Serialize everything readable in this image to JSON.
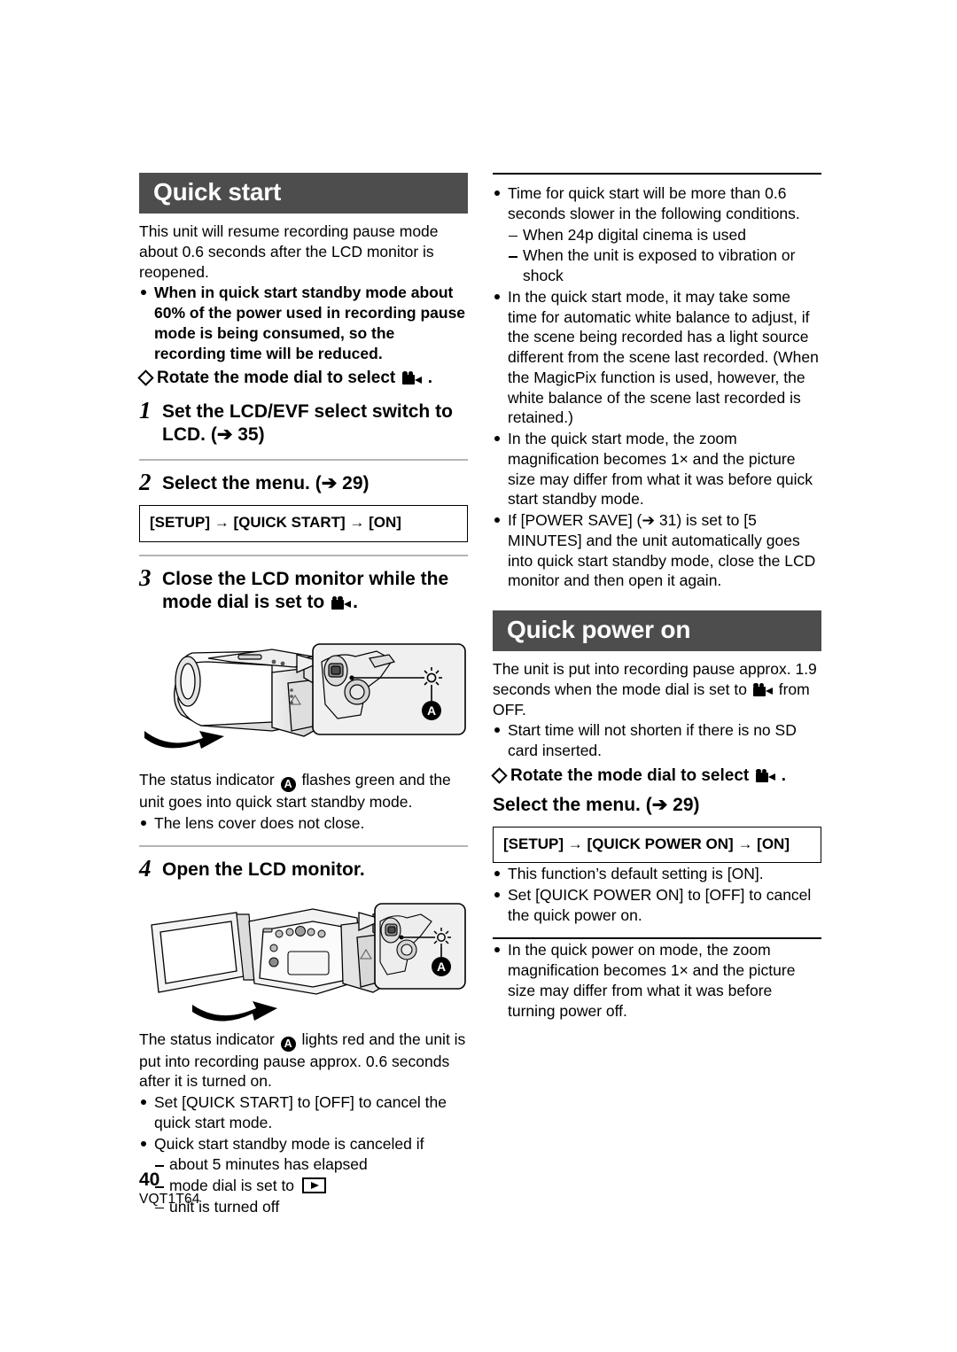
{
  "left": {
    "section_title": "Quick start",
    "intro": "This unit will resume recording pause mode about 0.6 seconds after the LCD monitor is reopened.",
    "intro_bullets": [
      "When in quick start standby mode about 60% of the power used in recording pause mode is being consumed, so the recording time will be reduced."
    ],
    "dial_prompt": "Rotate the mode dial to select",
    "dial_prompt_suffix": ".",
    "steps": [
      {
        "num": "1",
        "text": "Set the LCD/EVF select switch to LCD. (➔ 35)"
      },
      {
        "num": "2",
        "text": "Select the menu. (➔ 29)"
      },
      {
        "num": "3",
        "text_before": "Close the LCD monitor while the mode dial is set to",
        "text_after": "."
      },
      {
        "num": "4",
        "text": "Open the LCD monitor."
      }
    ],
    "menu_path": "[SETUP] → [QUICK START] → [ON]",
    "fig1_caption_before": "The status indicator",
    "fig1_caption_after": "flashes green and the unit goes into quick start standby mode.",
    "fig1_bullets": [
      "The lens cover does not close."
    ],
    "fig2_caption_before": "The status indicator",
    "fig2_caption_after": "lights red and the unit is put into recording pause approx. 0.6 seconds after it is turned on.",
    "fig2_bullets": [
      "Set [QUICK START] to [OFF] to cancel the quick start mode."
    ],
    "cancel_lead": "Quick start standby mode is canceled if",
    "cancel_items": [
      {
        "text": "about 5 minutes has elapsed",
        "icon": null
      },
      {
        "text": "mode dial is set to",
        "icon": "play-icon"
      },
      {
        "text": "unit is turned off",
        "icon": null
      }
    ],
    "badge_label": "A"
  },
  "right": {
    "top_bullets": [
      {
        "text": "Time for quick start will be more than 0.6 seconds slower in the following conditions.",
        "sub": [
          "When 24p digital cinema is used",
          "When the unit is exposed to vibration or shock"
        ]
      },
      {
        "text": "In the quick start mode, it may take some time for automatic white balance to adjust, if the scene being recorded has a light source different from the scene last recorded. (When the MagicPix function is used, however, the white balance of the scene last recorded is retained.)",
        "sub": []
      },
      {
        "text": "In the quick start mode, the zoom magnification becomes 1× and the picture size may differ from what it was before quick start standby mode.",
        "sub": []
      },
      {
        "text": "If [POWER SAVE] (➔ 31) is set to [5 MINUTES] and the unit automatically goes into quick start standby mode, close the LCD monitor and then open it again.",
        "sub": []
      }
    ],
    "section_title": "Quick power on",
    "intro_before": "The unit is put into recording pause approx. 1.9 seconds when the mode dial is set to",
    "intro_after": "from OFF.",
    "intro_bullets": [
      "Start time will not shorten if there is no SD card inserted."
    ],
    "dial_prompt": "Rotate the mode dial to select",
    "dial_prompt_suffix": ".",
    "select_menu": "Select the menu. (➔ 29)",
    "menu_path": "[SETUP] → [QUICK POWER ON] → [ON]",
    "after_bullets": [
      "This function’s default setting is [ON].",
      "Set [QUICK POWER ON] to [OFF] to cancel the quick power on."
    ],
    "final_bullets": [
      "In the quick power on mode, the zoom magnification becomes 1× and the picture size may differ from what it was before turning power off."
    ]
  },
  "footer": {
    "page_number": "40",
    "doc_code": "VQT1T64"
  },
  "colors": {
    "header_bar": "#4d4d4d",
    "header_text": "#ffffff",
    "rule_grey": "#b4b4b4",
    "text": "#000000"
  }
}
